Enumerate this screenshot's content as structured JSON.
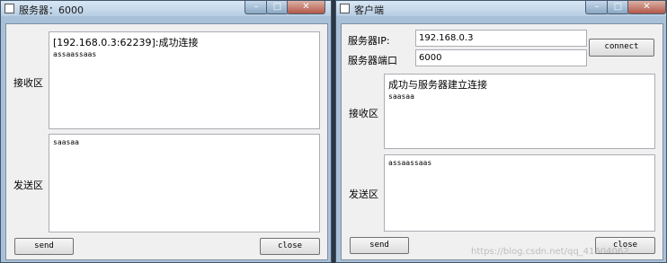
{
  "server": {
    "title": "服务器：6000",
    "controls": {
      "minimize": "–",
      "maximize": "□",
      "close": "✕"
    },
    "receive_label": "接收区",
    "receive_lines": [
      "[192.168.0.3:62239]:成功连接",
      "assaassaas"
    ],
    "send_label": "发送区",
    "send_text": "saasaa",
    "send_button": "send",
    "close_button": "close"
  },
  "client": {
    "title": "客户端",
    "controls": {
      "minimize": "–",
      "maximize": "□",
      "close": "✕"
    },
    "ip_label": "服务器IP:",
    "ip_value": "192.168.0.3",
    "port_label": "服务器端口",
    "port_value": "6000",
    "connect_button": "connect",
    "receive_label": "接收区",
    "receive_lines": [
      "成功与服务器建立连接",
      "saasaa"
    ],
    "send_label": "发送区",
    "send_text": "assaassaas",
    "send_button": "send",
    "close_button": "close",
    "watermark": "https://blog.csdn.net/qq_41604062"
  }
}
